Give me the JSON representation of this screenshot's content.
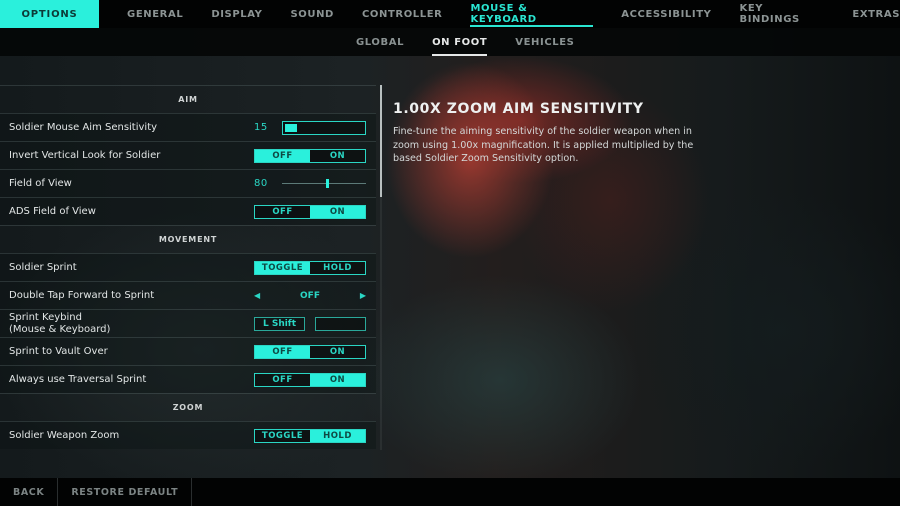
{
  "header": {
    "options_label": "OPTIONS",
    "tabs": [
      {
        "label": "GENERAL",
        "active": false
      },
      {
        "label": "DISPLAY",
        "active": false
      },
      {
        "label": "SOUND",
        "active": false
      },
      {
        "label": "CONTROLLER",
        "active": false
      },
      {
        "label": "MOUSE & KEYBOARD",
        "active": true
      },
      {
        "label": "ACCESSIBILITY",
        "active": false
      },
      {
        "label": "KEY BINDINGS",
        "active": false
      },
      {
        "label": "EXTRAS",
        "active": false
      }
    ],
    "subtabs": [
      {
        "label": "GLOBAL",
        "active": false
      },
      {
        "label": "ON FOOT",
        "active": true
      },
      {
        "label": "VEHICLES",
        "active": false
      }
    ]
  },
  "sections": {
    "aim": {
      "title": "AIM",
      "mouse_aim_sensitivity": {
        "label": "Soldier Mouse Aim Sensitivity",
        "value": "15",
        "fill_percent": 15
      },
      "invert_vertical": {
        "label": "Invert Vertical Look for Soldier",
        "options": [
          "OFF",
          "ON"
        ],
        "selected": "OFF"
      },
      "field_of_view": {
        "label": "Field of View",
        "value": "80",
        "min": 50,
        "max": 105
      },
      "ads_fov": {
        "label": "ADS Field of View",
        "options": [
          "OFF",
          "ON"
        ],
        "selected": "ON"
      }
    },
    "movement": {
      "title": "MOVEMENT",
      "soldier_sprint": {
        "label": "Soldier Sprint",
        "options": [
          "TOGGLE",
          "HOLD"
        ],
        "selected": "TOGGLE"
      },
      "double_tap": {
        "label": "Double Tap Forward to Sprint",
        "value": "OFF",
        "left_icon": "arrow-left-icon",
        "right_icon": "arrow-right-icon"
      },
      "sprint_keybind": {
        "label_line1": "Sprint Keybind",
        "label_line2": "(Mouse & Keyboard)",
        "primary": "L Shift",
        "secondary": ""
      },
      "sprint_vault": {
        "label": "Sprint to Vault Over",
        "options": [
          "OFF",
          "ON"
        ],
        "selected": "OFF"
      },
      "traversal_sprint": {
        "label": "Always use Traversal Sprint",
        "options": [
          "OFF",
          "ON"
        ],
        "selected": "ON"
      }
    },
    "zoom": {
      "title": "ZOOM",
      "weapon_zoom": {
        "label": "Soldier Weapon Zoom",
        "options": [
          "TOGGLE",
          "HOLD"
        ],
        "selected": "HOLD"
      }
    }
  },
  "description": {
    "title": "1.00X ZOOM AIM SENSITIVITY",
    "body": "Fine-tune the aiming sensitivity of the soldier weapon when in zoom using 1.00x magnification. It is applied multiplied by the based Soldier Zoom Sensitivity option."
  },
  "footer": {
    "back_label": "BACK",
    "restore_label": "RESTORE DEFAULT"
  },
  "colors": {
    "accent": "#2af0dc",
    "accent_text_dark": "#0e4a44",
    "top_bar": "#020303"
  }
}
